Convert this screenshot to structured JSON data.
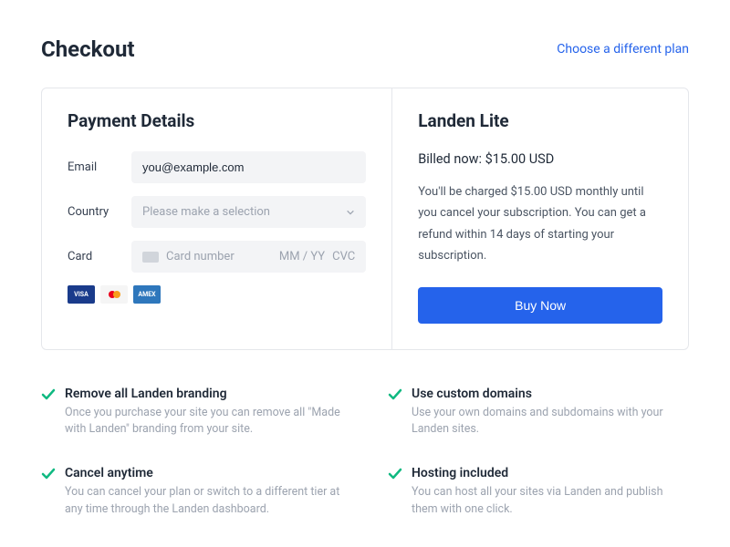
{
  "header": {
    "title": "Checkout",
    "change_plan_link": "Choose a different plan"
  },
  "payment": {
    "title": "Payment Details",
    "email_label": "Email",
    "email_value": "you@example.com",
    "country_label": "Country",
    "country_placeholder": "Please make a selection",
    "card_label": "Card",
    "card_number_placeholder": "Card number",
    "card_expiry_placeholder": "MM / YY",
    "card_cvc_placeholder": "CVC",
    "brands": {
      "visa": "VISA",
      "amex": "AMEX"
    }
  },
  "plan": {
    "name": "Landen Lite",
    "billed_now": "Billed now: $15.00 USD",
    "description": "You'll be charged $15.00 USD monthly until you cancel your subscription. You can get a refund within 14 days of starting your subscription.",
    "buy_label": "Buy Now"
  },
  "features": [
    {
      "title": "Remove all Landen branding",
      "desc": "Once you purchase your site you can remove all \"Made with Landen\" branding from your site."
    },
    {
      "title": "Use custom domains",
      "desc": "Use your own domains and subdomains with your Landen sites."
    },
    {
      "title": "Cancel anytime",
      "desc": "You can cancel your plan or switch to a different tier at any time through the Landen dashboard."
    },
    {
      "title": "Hosting included",
      "desc": "You can host all your sites via Landen and publish them with one click."
    }
  ]
}
